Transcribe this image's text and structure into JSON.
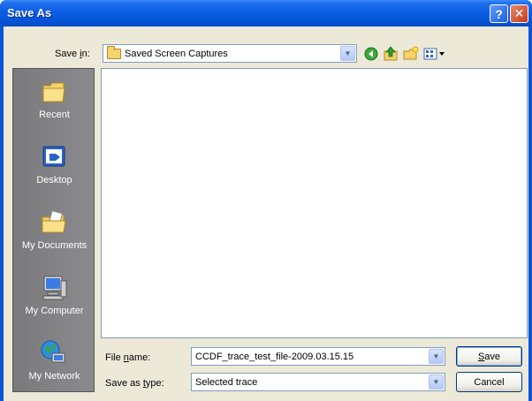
{
  "window": {
    "title": "Save As"
  },
  "titlebar": {
    "help_label": "?",
    "close_label": "✕"
  },
  "toolbar": {
    "save_in_label_pre": "Save ",
    "save_in_label_key": "i",
    "save_in_label_post": "n:",
    "save_in_value": "Saved Screen Captures",
    "icons": [
      "back-icon",
      "up-folder-icon",
      "new-folder-icon",
      "views-menu-icon"
    ]
  },
  "places": [
    {
      "label": "Recent",
      "icon": "recent-icon"
    },
    {
      "label": "Desktop",
      "icon": "desktop-icon"
    },
    {
      "label": "My Documents",
      "icon": "my-documents-icon"
    },
    {
      "label": "My Computer",
      "icon": "my-computer-icon"
    },
    {
      "label": "My Network",
      "icon": "my-network-icon"
    }
  ],
  "form": {
    "file_name_label_pre": "File ",
    "file_name_label_key": "n",
    "file_name_label_post": "ame:",
    "file_name_value": "CCDF_trace_test_file-2009.03.15.15",
    "save_type_label_pre": "Save as ",
    "save_type_label_key": "t",
    "save_type_label_post": "ype:",
    "save_type_value": "Selected trace"
  },
  "buttons": {
    "save_key": "S",
    "save_rest": "ave",
    "cancel": "Cancel"
  },
  "colors": {
    "titlebar": "#0a5ee4",
    "client": "#ece9d8",
    "places_bar": "#7a7a7d",
    "field_border": "#7f9db9"
  }
}
